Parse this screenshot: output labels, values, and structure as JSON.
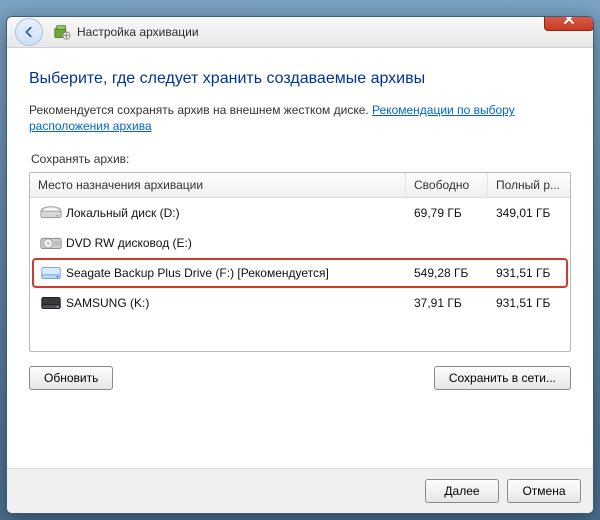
{
  "titlebar": {
    "title": "Настройка архивации"
  },
  "body": {
    "heading": "Выберите, где следует хранить создаваемые архивы",
    "hint_text": "Рекомендуется сохранять архив на внешнем жестком диске. ",
    "hint_link": "Рекомендации по выбору расположения архива",
    "save_label": "Сохранять архив:",
    "columns": {
      "destination": "Место назначения архивации",
      "free": "Свободно",
      "total": "Полный р..."
    },
    "rows": [
      {
        "icon": "hdd",
        "name": "Локальный диск (D:)",
        "free": "69,79 ГБ",
        "total": "349,01 ГБ",
        "highlight": false
      },
      {
        "icon": "dvd",
        "name": "DVD RW дисковод (E:)",
        "free": "",
        "total": "",
        "highlight": false
      },
      {
        "icon": "ext-hdd",
        "name": "Seagate Backup Plus Drive (F:) [Рекомендуется]",
        "free": "549,28 ГБ",
        "total": "931,51 ГБ",
        "highlight": true
      },
      {
        "icon": "ext-hdd2",
        "name": "SAMSUNG (K:)",
        "free": "37,91 ГБ",
        "total": "931,51 ГБ",
        "highlight": false
      }
    ],
    "refresh_btn": "Обновить",
    "network_btn": "Сохранить в сети..."
  },
  "footer": {
    "next": "Далее",
    "cancel": "Отмена"
  }
}
